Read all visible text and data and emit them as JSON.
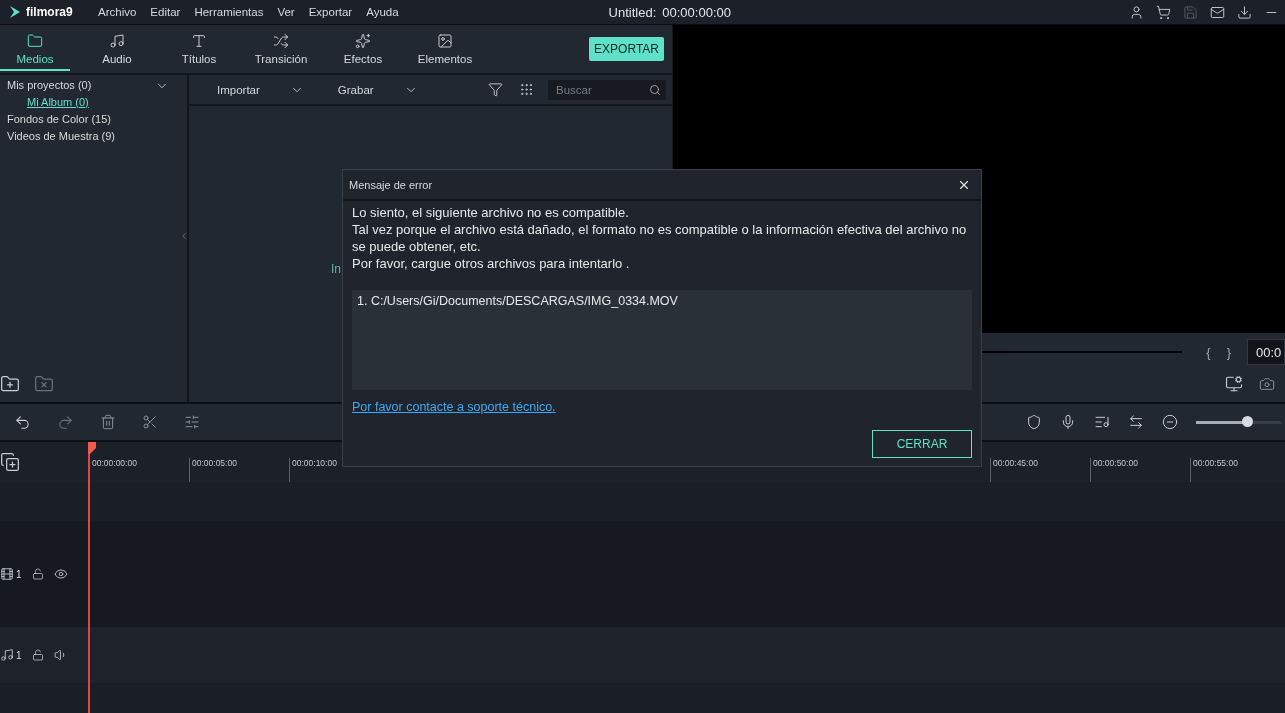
{
  "menu_bar": {
    "logo": "filmora9",
    "items": [
      "Archivo",
      "Editar",
      "Herramientas",
      "Ver",
      "Exportar",
      "Ayuda"
    ],
    "title": "Untitled:",
    "timecode": "00:00:00:00"
  },
  "tabs": [
    {
      "label": "Medios",
      "selected": true
    },
    {
      "label": "Audio",
      "selected": false
    },
    {
      "label": "Títulos",
      "selected": false
    },
    {
      "label": "Transición",
      "selected": false
    },
    {
      "label": "Efectos",
      "selected": false
    },
    {
      "label": "Elementos",
      "selected": false
    }
  ],
  "export_button": "EXPORTAR",
  "sidebar": {
    "items": [
      {
        "label": "Mis proyectos (0)",
        "expanded": true,
        "children": [
          {
            "label": "Mi Album (0)",
            "selected": true
          }
        ]
      },
      {
        "label": "Fondos de Color (15)",
        "expanded": false
      },
      {
        "label": "Videos de Muestra (9)",
        "expanded": false
      }
    ]
  },
  "media_toolbar": {
    "import": "Importar",
    "record": "Grabar",
    "search": {
      "placeholder": "Buscar"
    }
  },
  "media_hint": "In",
  "preview": {
    "mark_in": "{",
    "mark_out": "}",
    "timecode": "00:0"
  },
  "zoom_slider": {
    "level": 0.6
  },
  "ruler_start": [
    "00:00:00:00",
    "00:00:05:00",
    "00:00:10:00"
  ],
  "ruler_end": [
    "00:00:45:00",
    "00:00:50:00",
    "00:00:55:00"
  ],
  "tracks": [
    {
      "kind": "video",
      "number": "1"
    },
    {
      "kind": "audio",
      "number": "1"
    }
  ],
  "dialog": {
    "title": "Mensaje de error",
    "lines": [
      "Lo siento, el siguiente archivo no es compatible.",
      "Tal vez porque el archivo está dañado, el formato no es compatible o la información efectiva del archivo no se puede obtener, etc.",
      "Por favor, cargue otros archivos para intentarlo ."
    ],
    "files": [
      "1. C:/Users/Gi/Documents/DESCARGAS/IMG_0334.MOV"
    ],
    "support_link": "Por favor contacte a soporte técnico.",
    "close_button": "CERRAR"
  }
}
